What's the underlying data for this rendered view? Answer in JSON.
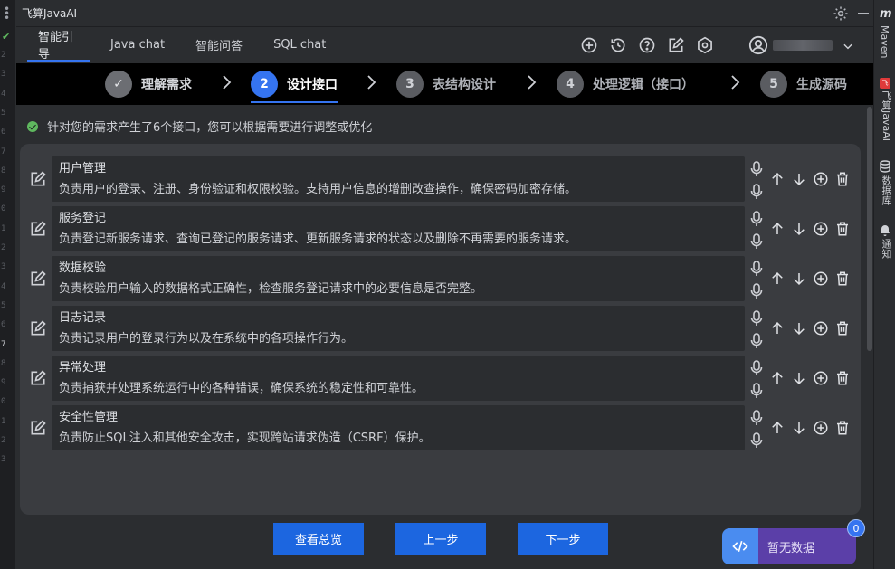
{
  "app": {
    "panel_title": "飞算JavaAI",
    "tabs": [
      {
        "label": "智能引导"
      },
      {
        "label": "Java chat"
      },
      {
        "label": "智能问答"
      },
      {
        "label": "SQL chat"
      }
    ]
  },
  "gutter": {
    "line_numbers": [
      "2",
      "3",
      "4",
      "5",
      "6",
      "7",
      "8",
      "9",
      "0",
      "1",
      "2",
      "3",
      "4",
      "5",
      "6",
      "7",
      "8",
      "9",
      "0",
      "1",
      "2",
      "3"
    ],
    "highlighted_index": 15
  },
  "steps": [
    {
      "number": "✓",
      "label": "理解需求",
      "state": "done"
    },
    {
      "number": "2",
      "label": "设计接口",
      "state": "active"
    },
    {
      "number": "3",
      "label": "表结构设计",
      "state": "pending"
    },
    {
      "number": "4",
      "label": "处理逻辑（接口）",
      "state": "pending"
    },
    {
      "number": "5",
      "label": "生成源码",
      "state": "pending"
    }
  ],
  "notice": "针对您的需求产生了6个接口，您可以根据需要进行调整或优化",
  "interfaces": [
    {
      "name": "用户管理",
      "desc": "负责用户的登录、注册、身份验证和权限校验。支持用户信息的增删改查操作，确保密码加密存储。"
    },
    {
      "name": "服务登记",
      "desc": "负责登记新服务请求、查询已登记的服务请求、更新服务请求的状态以及删除不再需要的服务请求。"
    },
    {
      "name": "数据校验",
      "desc": "负责校验用户输入的数据格式正确性，检查服务登记请求中的必要信息是否完整。"
    },
    {
      "name": "日志记录",
      "desc": "负责记录用户的登录行为以及在系统中的各项操作行为。"
    },
    {
      "name": "异常处理",
      "desc": "负责捕获并处理系统运行中的各种错误，确保系统的稳定性和可靠性。"
    },
    {
      "name": "安全性管理",
      "desc": "负责防止SQL注入和其他安全攻击，实现跨站请求伪造（CSRF）保护。"
    }
  ],
  "buttons": {
    "overview": "查看总览",
    "prev": "上一步",
    "next": "下一步"
  },
  "widget": {
    "label": "暂无数据",
    "badge": "0"
  },
  "right_rail": {
    "maven": "Maven",
    "javaai": "飞算JavaAI",
    "database": "数据库",
    "notify": "通知"
  },
  "colors": {
    "accent": "#3574f0",
    "primary_button": "#1c66e0",
    "success": "#5fb85f",
    "panel_bg": "#2b2d30",
    "card_bg": "#3a3c40",
    "widget_purple": "#5b3fa8"
  }
}
